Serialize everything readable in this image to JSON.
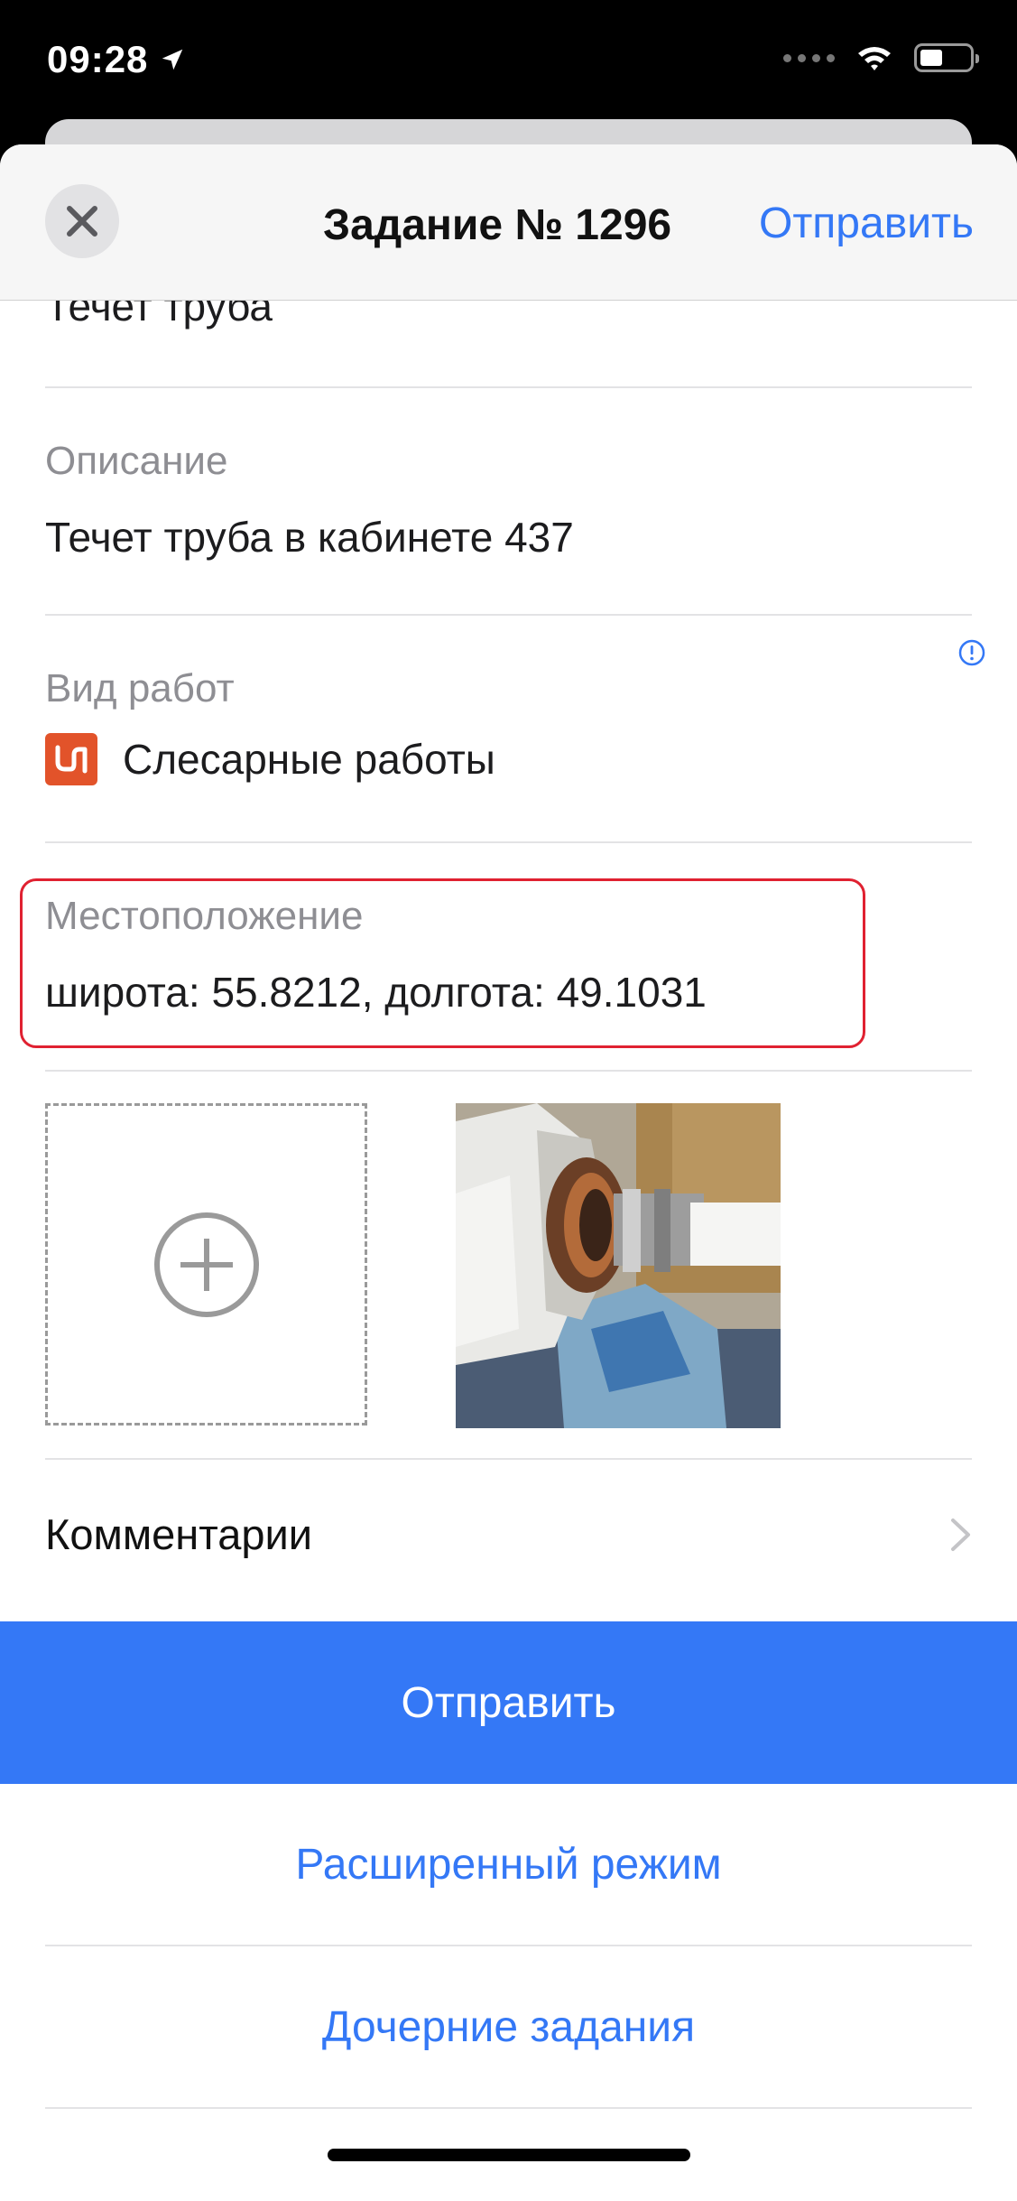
{
  "status_bar": {
    "time": "09:28",
    "icons": [
      "location-arrow-icon",
      "signal-dots-icon",
      "wifi-icon",
      "battery-icon"
    ]
  },
  "nav": {
    "title": "Задание № 1296",
    "send_label": "Отправить",
    "close_icon": "close-icon"
  },
  "form": {
    "topic_value": "Течет труба",
    "description": {
      "label": "Описание",
      "value": "Течет труба в кабинете 437"
    },
    "work_type": {
      "label": "Вид работ",
      "value": "Слесарные работы",
      "icon": "pipe-icon"
    },
    "location": {
      "label": "Местоположение",
      "value": "широта: 55.8212, долгота: 49.1031"
    }
  },
  "photos": {
    "add_icon": "plus-circle-icon",
    "thumbnail_icon": "photo-thumbnail"
  },
  "comments": {
    "label": "Комментарии",
    "icon": "chevron-right-icon"
  },
  "actions": {
    "send_label": "Отправить",
    "advanced_label": "Расширенный режим",
    "subtasks_label": "Дочерние задания"
  },
  "colors": {
    "accent": "#3478f6",
    "highlight": "#e02131",
    "worktype_icon_bg": "#e2532a"
  }
}
